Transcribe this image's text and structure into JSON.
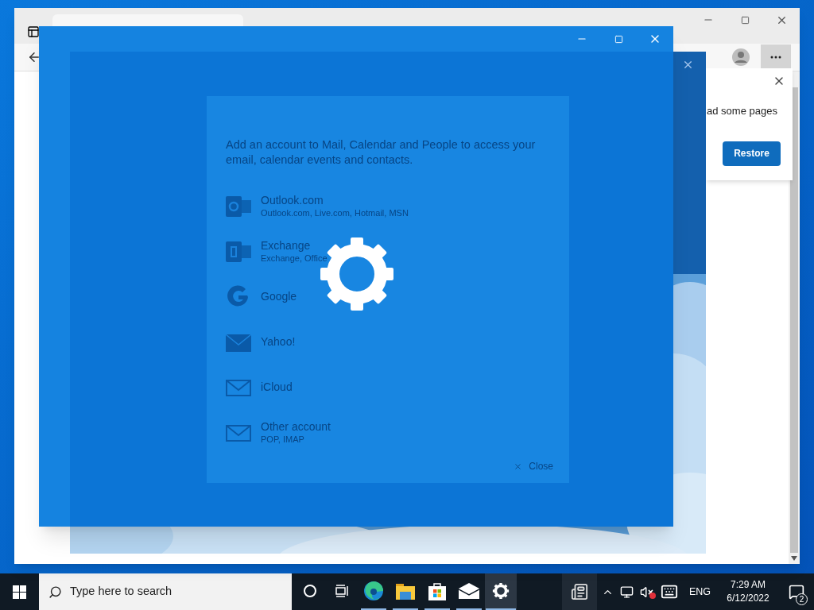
{
  "browser": {
    "restore_popup": {
      "message": "ad some pages",
      "button": "Restore"
    }
  },
  "mail_window": {
    "dialog": {
      "intro": "Add an account to Mail, Calendar and People to access your email, calendar events and contacts.",
      "accounts": [
        {
          "kind": "outlook",
          "name": "Outlook.com",
          "detail": "Outlook.com, Live.com, Hotmail, MSN"
        },
        {
          "kind": "exchange",
          "name": "Exchange",
          "detail": "Exchange, Office"
        },
        {
          "kind": "google",
          "name": "Google"
        },
        {
          "kind": "mail_solid",
          "name": "Yahoo!"
        },
        {
          "kind": "mail",
          "name": "iCloud"
        },
        {
          "kind": "mail",
          "name": "Other account",
          "detail": "POP, IMAP"
        }
      ],
      "close": "Close"
    }
  },
  "taskbar": {
    "search_placeholder": "Type here to search",
    "apps": [
      {
        "kind": "cortana",
        "running": false,
        "selected": false
      },
      {
        "kind": "taskview",
        "running": false,
        "selected": false
      },
      {
        "kind": "edge",
        "running": true,
        "selected": false
      },
      {
        "kind": "explorer",
        "running": true,
        "selected": false
      },
      {
        "kind": "store",
        "running": true,
        "selected": false
      },
      {
        "kind": "mail",
        "running": true,
        "selected": false
      },
      {
        "kind": "settings",
        "running": true,
        "selected": true
      }
    ],
    "language": "ENG",
    "time": "7:29 AM",
    "date": "6/12/2022",
    "notifications": "2"
  }
}
